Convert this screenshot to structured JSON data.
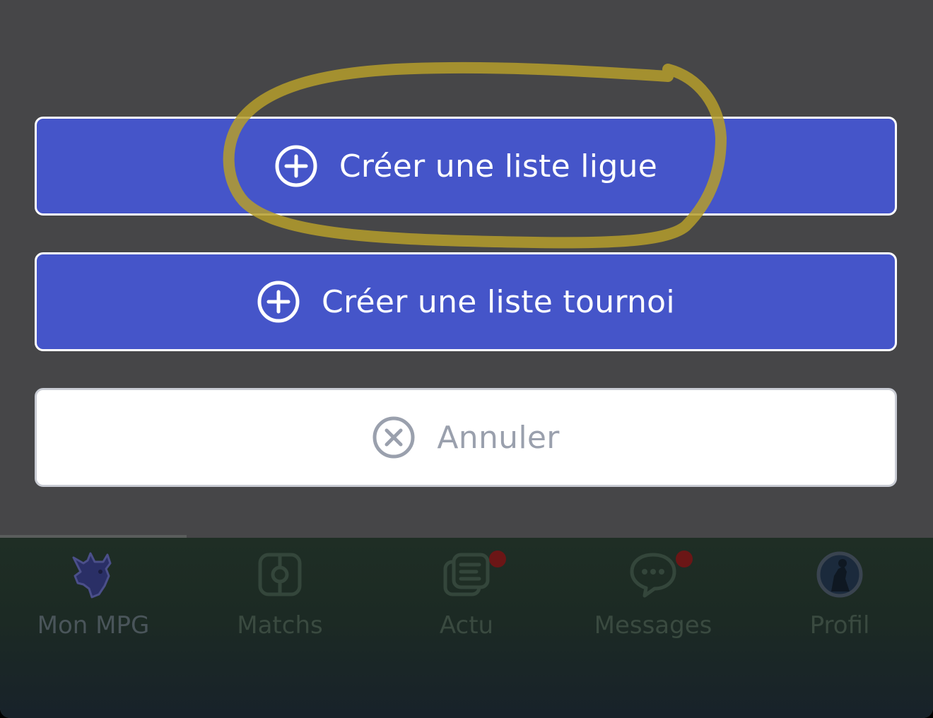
{
  "actions": {
    "create_league_list": "Créer une liste ligue",
    "create_tournament_list": "Créer une liste tournoi",
    "cancel": "Annuler"
  },
  "icons": {
    "plus": "plus-circle-icon",
    "cancel": "x-circle-icon"
  },
  "colors": {
    "overlay": "#464648",
    "primary_button": "#4555c9",
    "highlight": "#b59d2c",
    "badge": "#6b1616"
  },
  "tabbar": {
    "tabs": [
      {
        "label": "Mon MPG",
        "icon": "goat-icon",
        "active": true
      },
      {
        "label": "Matchs",
        "icon": "pitch-icon"
      },
      {
        "label": "Actu",
        "icon": "news-icon",
        "badge": true
      },
      {
        "label": "Messages",
        "icon": "chat-icon",
        "badge": true
      },
      {
        "label": "Profil",
        "icon": "avatar"
      }
    ]
  }
}
